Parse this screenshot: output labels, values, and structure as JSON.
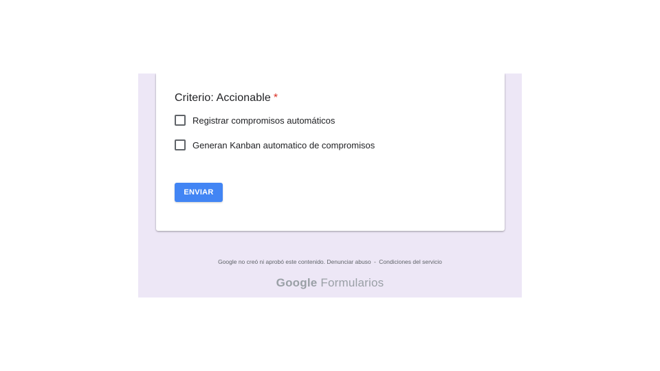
{
  "question": {
    "title": "Criterio: Accionable",
    "required_marker": "*",
    "options": [
      {
        "label": "Registrar compromisos automáticos",
        "checked": false
      },
      {
        "label": "Generan Kanban automatico de compromisos",
        "checked": false
      }
    ]
  },
  "actions": {
    "submit_label": "ENVIAR"
  },
  "footer": {
    "disclaimer": "Google no creó ni aprobó este contenido.",
    "report_abuse": "Denunciar abuso",
    "separator": "-",
    "terms": "Condiciones del servicio",
    "brand_google": "Google",
    "brand_product": "Formularios"
  },
  "colors": {
    "accent": "#4285f4",
    "page_background": "#ede7f6",
    "required": "#d93025"
  }
}
